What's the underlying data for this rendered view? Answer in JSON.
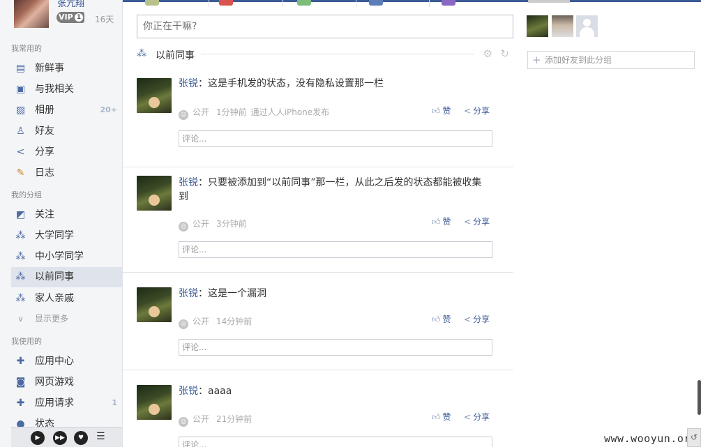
{
  "profile": {
    "name": "张亢翔",
    "vip_label": "VIP",
    "vip_level": "1",
    "days": "16天"
  },
  "sidebar": {
    "section_common": "我常用的",
    "common_items": [
      {
        "label": "新鲜事",
        "icon": "newsfeed-icon",
        "count": ""
      },
      {
        "label": "与我相关",
        "icon": "mentions-icon",
        "count": ""
      },
      {
        "label": "相册",
        "icon": "photo-album-icon",
        "count": "20+"
      },
      {
        "label": "好友",
        "icon": "friends-icon",
        "count": ""
      },
      {
        "label": "分享",
        "icon": "share-icon",
        "count": ""
      },
      {
        "label": "日志",
        "icon": "blog-icon",
        "count": ""
      }
    ],
    "section_groups": "我的分组",
    "group_items": [
      {
        "label": "关注",
        "icon": "rss-icon"
      },
      {
        "label": "大学同学",
        "icon": "group-icon"
      },
      {
        "label": "中小学同学",
        "icon": "group-icon"
      },
      {
        "label": "以前同事",
        "icon": "group-icon"
      },
      {
        "label": "家人亲戚",
        "icon": "group-icon"
      }
    ],
    "show_more": "显示更多",
    "section_used": "我使用的",
    "used_items": [
      {
        "label": "应用中心",
        "icon": "puzzle-icon",
        "count": ""
      },
      {
        "label": "网页游戏",
        "icon": "gamepad-icon",
        "count": ""
      },
      {
        "label": "应用请求",
        "icon": "puzzle-icon",
        "count": "1"
      },
      {
        "label": "状态",
        "icon": "status-icon",
        "count": ""
      }
    ]
  },
  "composer": {
    "placeholder": "你正在干嘛?"
  },
  "group": {
    "title": "以前同事"
  },
  "posts": [
    {
      "author": "张锐",
      "text": "：这是手机发的状态，没有隐私设置那一栏",
      "privacy": "公开",
      "time": "1分钟前",
      "source": "通过人人iPhone发布",
      "like": "赞",
      "share": "分享",
      "comment_placeholder": "评论..."
    },
    {
      "author": "张锐",
      "text": "：只要被添加到“以前同事”那一栏，从此之后发的状态都能被收集到",
      "privacy": "公开",
      "time": "3分钟前",
      "source": "",
      "like": "赞",
      "share": "分享",
      "comment_placeholder": "评论..."
    },
    {
      "author": "张锐",
      "text": "：这是一个漏洞",
      "privacy": "公开",
      "time": "14分钟前",
      "source": "",
      "like": "赞",
      "share": "分享",
      "comment_placeholder": "评论..."
    },
    {
      "author": "张锐",
      "text": "：aaaa",
      "privacy": "公开",
      "time": "21分钟前",
      "source": "",
      "like": "赞",
      "share": "分享",
      "comment_placeholder": "评论..."
    }
  ],
  "right": {
    "add_friend_label": "添加好友到此分组"
  },
  "watermark": "www.wooyun.org",
  "colors": {
    "accent": "#3b5a96",
    "active_bg": "#dfe3ec",
    "sidebar_bg": "#f4f5f7"
  }
}
